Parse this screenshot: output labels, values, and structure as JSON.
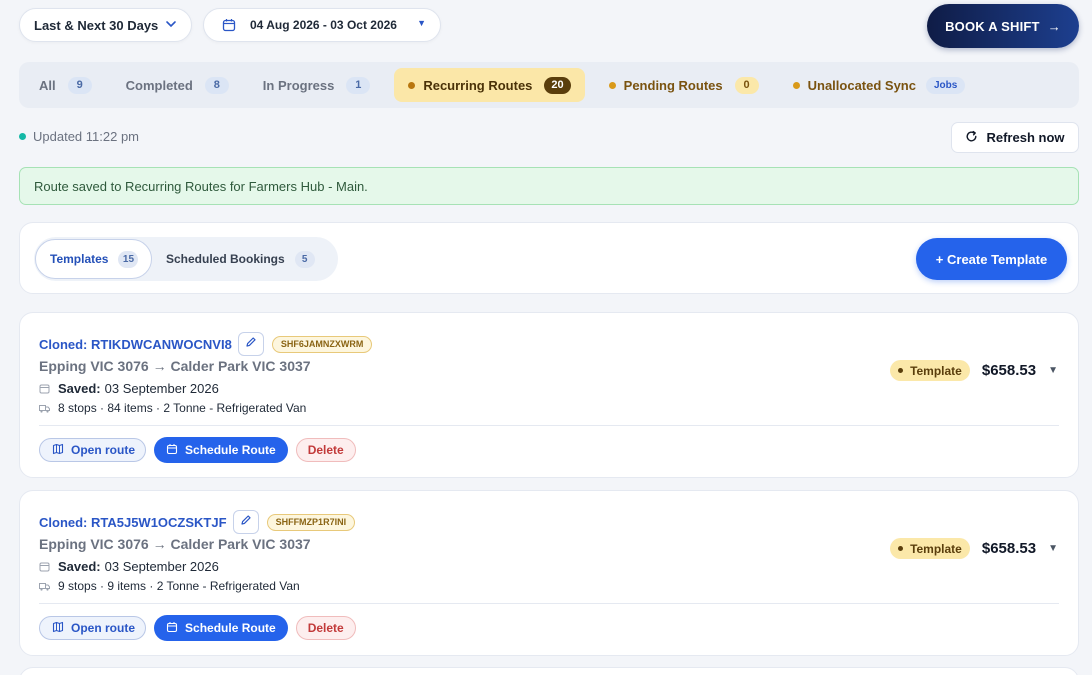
{
  "filters": {
    "range_label": "Last & Next 30 Days",
    "date_range": "04 Aug 2026 - 03 Oct 2026",
    "book_label": "BOOK A SHIFT",
    "book_arrow": "→"
  },
  "tabs": [
    {
      "label": "All",
      "count": "9",
      "state": "normal"
    },
    {
      "label": "Completed",
      "count": "8",
      "state": "normal"
    },
    {
      "label": "In Progress",
      "count": "1",
      "state": "normal"
    },
    {
      "label": "Recurring Routes",
      "count": "20",
      "state": "active"
    },
    {
      "label": "Pending Routes",
      "count": "0",
      "state": "amber"
    },
    {
      "label": "Unallocated Sync",
      "badge": "Jobs",
      "state": "amber"
    }
  ],
  "status": {
    "updated": "Updated 11:22 pm",
    "refresh_label": "Refresh now"
  },
  "alert": {
    "message": "Route saved to Recurring Routes for Farmers Hub - Main."
  },
  "subtabs": [
    {
      "label": "Templates",
      "count": "15",
      "active": true
    },
    {
      "label": "Scheduled Bookings",
      "count": "5",
      "active": false
    }
  ],
  "create_label": "+ Create Template",
  "cards": [
    {
      "title": "Cloned: RTIKDWCANWOCNVI8",
      "ref": "SHF6JAMNZXWRM",
      "route": "Epping VIC 3076 → Calder Park VIC 3037",
      "saved_label": "Saved:",
      "saved_date": "03 September 2026",
      "meta": "8 stops · 84 items · 2 Tonne - Refrigerated Van",
      "badge": "Template",
      "price": "$658.53",
      "open_label": "Open route",
      "schedule_label": "Schedule Route",
      "delete_label": "Delete"
    },
    {
      "title": "Cloned: RTA5J5W1OCZSKTJF",
      "ref": "SHFFMZP1R7INI",
      "route": "Epping VIC 3076 → Calder Park VIC 3037",
      "saved_label": "Saved:",
      "saved_date": "03 September 2026",
      "meta": "9 stops · 9 items · 2 Tonne - Refrigerated Van",
      "badge": "Template",
      "price": "$658.53",
      "open_label": "Open route",
      "schedule_label": "Schedule Route",
      "delete_label": "Delete"
    }
  ],
  "colors": {
    "accent": "#2563eb",
    "recurring_active_bg": "#fbe7a8",
    "success_bg": "#e5f8ea",
    "delete": "#c23a3a"
  },
  "icons": [
    "chevron-down-icon",
    "calendar-icon",
    "arrow-right-icon",
    "refresh-icon",
    "pencil-icon",
    "truck-icon",
    "map-icon",
    "caret-down-icon"
  ]
}
